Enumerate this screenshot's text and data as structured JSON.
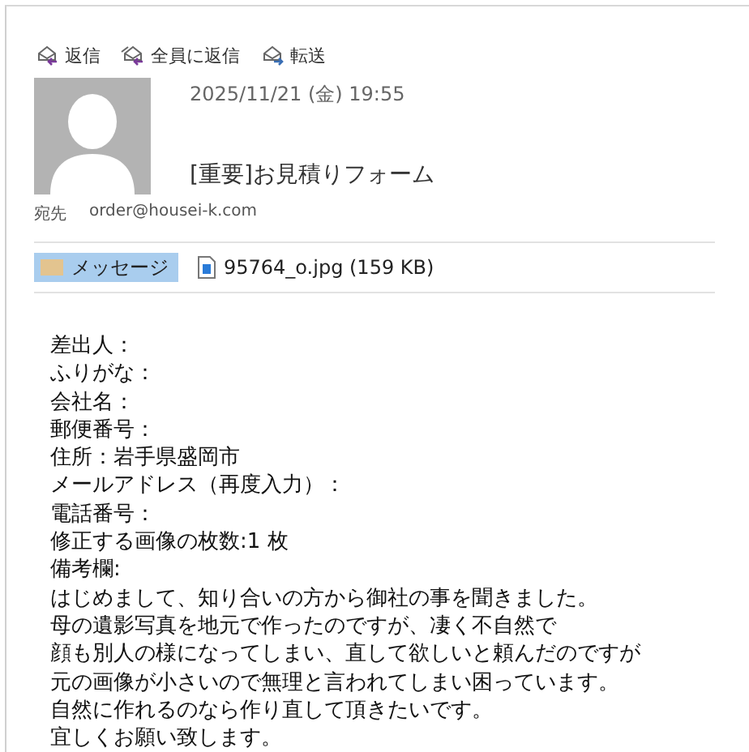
{
  "toolbar": [
    {
      "kind": "reply",
      "label": "返信"
    },
    {
      "kind": "reply-all",
      "label": "全員に返信"
    },
    {
      "kind": "forward",
      "label": "転送"
    }
  ],
  "header": {
    "date": "2025/11/21 (金) 19:55",
    "subject": "[重要]お見積りフォーム",
    "to_label": "宛先",
    "to": "order@housei-k.com"
  },
  "attachments": [
    {
      "kind": "message",
      "label": "メッセージ",
      "selected": true
    },
    {
      "kind": "file",
      "label": "95764_o.jpg (159 KB)",
      "selected": false
    }
  ],
  "body": [
    "差出人：",
    "ふりがな：",
    "会社名：",
    "郵便番号：",
    "住所：岩手県盛岡市",
    "メールアドレス（再度入力）：",
    "電話番号：",
    "修正する画像の枚数:1 枚",
    "備考欄:",
    "はじめまして、知り合いの方から御社の事を聞きました。",
    "母の遺影写真を地元で作ったのですが、凄く不自然で",
    "顔も別人の様になってしまい、直して欲しいと頼んだのですが",
    "元の画像が小さいので無理と言われてしまい困っています。",
    "自然に作れるのなら作り直して頂きたいです。",
    "宜しくお願い致します。"
  ]
}
